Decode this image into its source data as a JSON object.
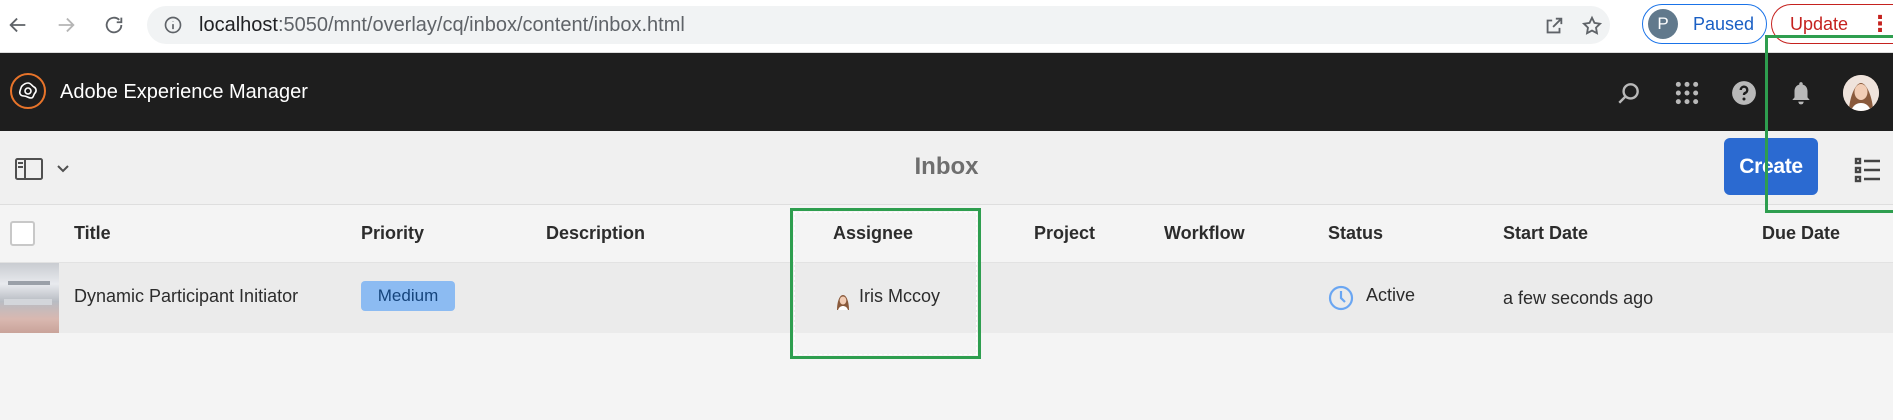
{
  "browser": {
    "url_host": "localhost",
    "url_path": ":5050/mnt/overlay/cq/inbox/content/inbox.html",
    "profile_initial": "P",
    "profile_status": "Paused",
    "update_label": "Update",
    "menu_glyph": "⋮"
  },
  "shell": {
    "app_title": "Adobe Experience Manager"
  },
  "action_bar": {
    "page_title": "Inbox",
    "create_label": "Create"
  },
  "table": {
    "columns": {
      "title": "Title",
      "priority": "Priority",
      "description": "Description",
      "assignee": "Assignee",
      "project": "Project",
      "workflow": "Workflow",
      "status": "Status",
      "start_date": "Start Date",
      "due_date": "Due Date"
    },
    "rows": [
      {
        "title": "Dynamic Participant Initiator",
        "priority": "Medium",
        "description": "",
        "assignee": "Iris Mccoy",
        "project": "",
        "workflow": "",
        "status": "Active",
        "start_date": "a few seconds ago",
        "due_date": ""
      }
    ]
  },
  "colors": {
    "shell_bg": "#1e1e1e",
    "create_button": "#2b6ad1",
    "priority_badge": "#8cbbf2",
    "highlight": "#2e9e4f",
    "status_active": "#6aa6f2"
  }
}
